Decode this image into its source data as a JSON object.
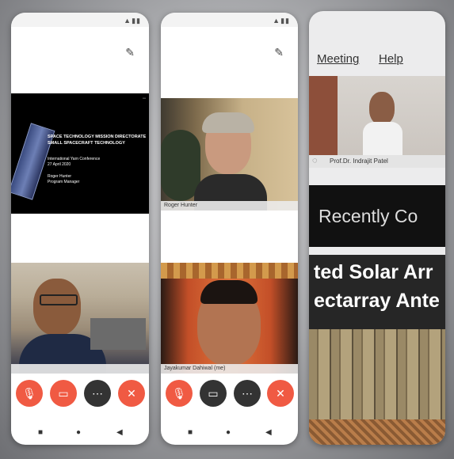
{
  "phone1": {
    "slide": {
      "title_line1": "SPACE TECHNOLOGY MISSION DIRECTORATE",
      "title_line2": "SMALL SPACECRAFT TECHNOLOGY",
      "line3": "International Yarn Conference",
      "line4": "27 April 2020",
      "line5": "Roger Hunter",
      "line6": "Program Manager"
    },
    "controls": [
      "mic-off-icon",
      "video-off-icon",
      "more-icon",
      "hangup-icon"
    ]
  },
  "phone2": {
    "video_name": "Roger Hunter",
    "bottom_name": "Jayakumar Dahiwal (me)",
    "controls": [
      "mic-off-icon",
      "video-icon",
      "more-icon",
      "hangup-icon"
    ]
  },
  "phone3": {
    "menu": [
      "Meeting",
      "Help"
    ],
    "participant_name": "Prof.Dr. Indrajit Patel",
    "recent_text": "Recently Co",
    "solar_line1": "ted Solar Arr",
    "solar_line2": "ectarray Ante"
  },
  "colors": {
    "accent_red": "#f05a43",
    "dark_button": "#333333"
  }
}
